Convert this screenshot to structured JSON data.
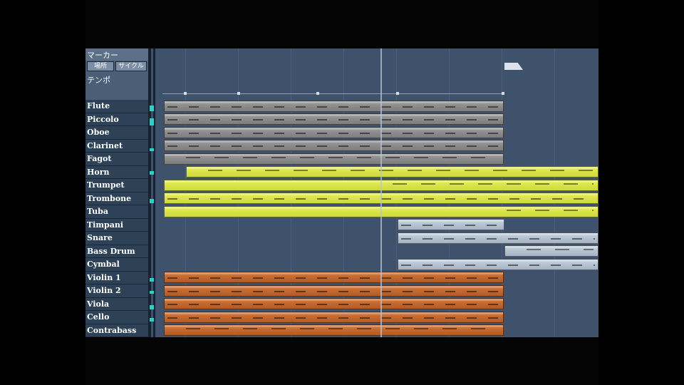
{
  "ruler": {
    "marker_label": "マーカー",
    "location_button": "場所",
    "cycle_button": "サイクル",
    "tempo_label": "テンポ"
  },
  "tracks": [
    {
      "name": "Flute"
    },
    {
      "name": "Piccolo"
    },
    {
      "name": "Oboe"
    },
    {
      "name": "Clarinet"
    },
    {
      "name": "Fagot"
    },
    {
      "name": "Horn"
    },
    {
      "name": "Trumpet"
    },
    {
      "name": "Trombone"
    },
    {
      "name": "Tuba"
    },
    {
      "name": "Timpani"
    },
    {
      "name": "Snare"
    },
    {
      "name": "Bass Drum"
    },
    {
      "name": "Cymbal"
    },
    {
      "name": "Violin 1"
    },
    {
      "name": "Violin 2"
    },
    {
      "name": "Viola"
    },
    {
      "name": "Cello"
    },
    {
      "name": "Contrabass"
    }
  ],
  "colors": {
    "woodwinds": "#8c8c8c",
    "brass": "#dbe44a",
    "percussion": "#b8c4d2",
    "strings": "#c66a2e",
    "background": "#3e536b"
  }
}
